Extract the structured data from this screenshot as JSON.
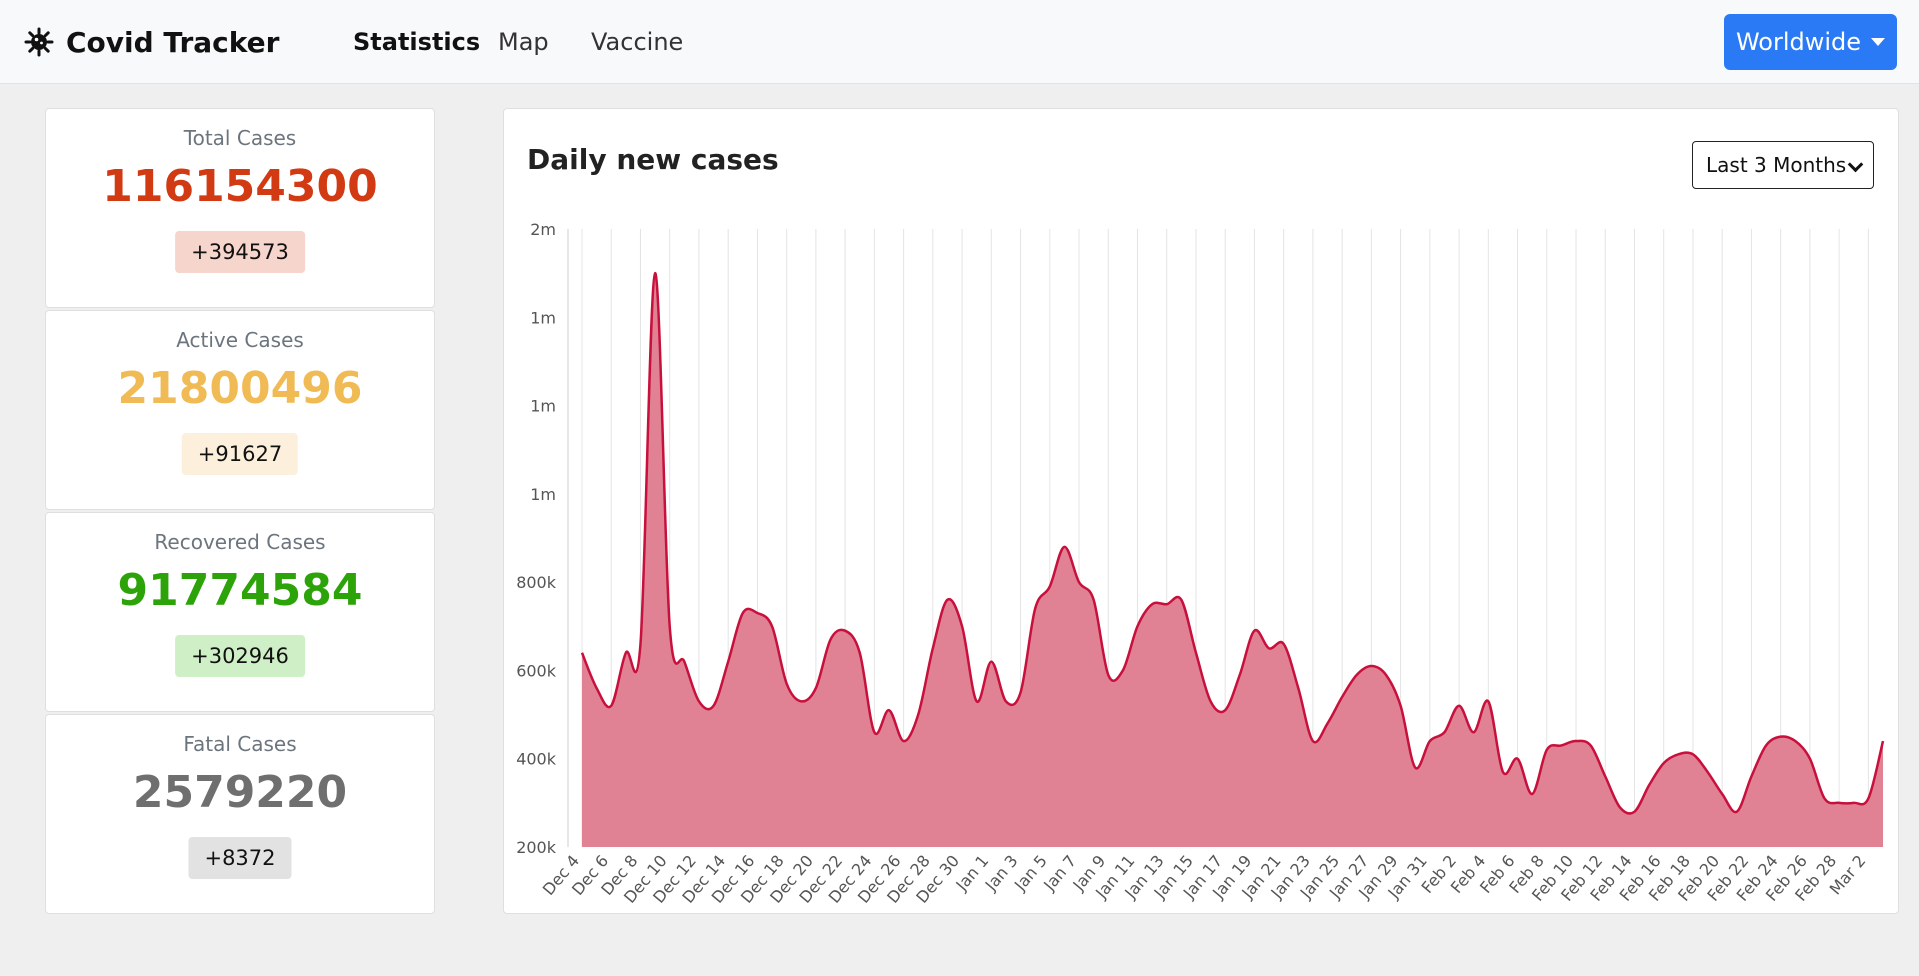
{
  "nav": {
    "brand": "Covid Tracker",
    "links": [
      "Statistics",
      "Map",
      "Vaccine"
    ],
    "region": "Worldwide"
  },
  "stats": [
    {
      "title": "Total Cases",
      "value": "116154300",
      "delta": "+394573",
      "color": "#d13a12",
      "bg": "#f5d5cc"
    },
    {
      "title": "Active Cases",
      "value": "21800496",
      "delta": "+91627",
      "color": "#f0bb55",
      "bg": "#fcf0dc"
    },
    {
      "title": "Recovered Cases",
      "value": "91774584",
      "delta": "+302946",
      "color": "#2da30a",
      "bg": "#cfefc6"
    },
    {
      "title": "Fatal Cases",
      "value": "2579220",
      "delta": "+8372",
      "color": "#6f6f6f",
      "bg": "#e2e2e2"
    }
  ],
  "chart": {
    "title": "Daily new cases",
    "range": "Last 3 Months"
  },
  "chart_data": {
    "type": "area",
    "line_color": "#c8103c",
    "fill_color": "#e08294",
    "grid": "vertical",
    "ylim": [
      200000,
      1600000
    ],
    "yticks": [
      200000,
      400000,
      600000,
      800000,
      1000000,
      1200000,
      1400000,
      1600000
    ],
    "ytick_labels": [
      "200k",
      "400k",
      "600k",
      "800k",
      "1m",
      "1m",
      "1m",
      "2m"
    ],
    "x": [
      "Dec 4",
      "Dec 5",
      "Dec 6",
      "Dec 7",
      "Dec 8",
      "Dec 9",
      "Dec 10",
      "Dec 11",
      "Dec 12",
      "Dec 13",
      "Dec 14",
      "Dec 15",
      "Dec 16",
      "Dec 17",
      "Dec 18",
      "Dec 19",
      "Dec 20",
      "Dec 21",
      "Dec 22",
      "Dec 23",
      "Dec 24",
      "Dec 25",
      "Dec 26",
      "Dec 27",
      "Dec 28",
      "Dec 29",
      "Dec 30",
      "Dec 31",
      "Jan 1",
      "Jan 2",
      "Jan 3",
      "Jan 4",
      "Jan 5",
      "Jan 6",
      "Jan 7",
      "Jan 8",
      "Jan 9",
      "Jan 10",
      "Jan 11",
      "Jan 12",
      "Jan 13",
      "Jan 14",
      "Jan 15",
      "Jan 16",
      "Jan 17",
      "Jan 18",
      "Jan 19",
      "Jan 20",
      "Jan 21",
      "Jan 22",
      "Jan 23",
      "Jan 24",
      "Jan 25",
      "Jan 26",
      "Jan 27",
      "Jan 28",
      "Jan 29",
      "Jan 30",
      "Jan 31",
      "Feb 1",
      "Feb 2",
      "Feb 3",
      "Feb 4",
      "Feb 5",
      "Feb 6",
      "Feb 7",
      "Feb 8",
      "Feb 9",
      "Feb 10",
      "Feb 11",
      "Feb 12",
      "Feb 13",
      "Feb 14",
      "Feb 15",
      "Feb 16",
      "Feb 17",
      "Feb 18",
      "Feb 19",
      "Feb 20",
      "Feb 21",
      "Feb 22",
      "Feb 23",
      "Feb 24",
      "Feb 25",
      "Feb 26",
      "Feb 27",
      "Feb 28",
      "Mar 1",
      "Mar 2",
      "Mar 3"
    ],
    "xtick_labels": [
      "Dec 4",
      "Dec 6",
      "Dec 8",
      "Dec 10",
      "Dec 12",
      "Dec 14",
      "Dec 16",
      "Dec 18",
      "Dec 20",
      "Dec 22",
      "Dec 24",
      "Dec 26",
      "Dec 28",
      "Dec 30",
      "Jan 1",
      "Jan 3",
      "Jan 5",
      "Jan 7",
      "Jan 9",
      "Jan 11",
      "Jan 13",
      "Jan 15",
      "Jan 17",
      "Jan 19",
      "Jan 21",
      "Jan 23",
      "Jan 25",
      "Jan 27",
      "Jan 29",
      "Jan 31",
      "Feb 2",
      "Feb 4",
      "Feb 6",
      "Feb 8",
      "Feb 10",
      "Feb 12",
      "Feb 14",
      "Feb 16",
      "Feb 18",
      "Feb 20",
      "Feb 22",
      "Feb 24",
      "Feb 26",
      "Feb 28",
      "Mar 2"
    ],
    "values": [
      640000,
      560000,
      520000,
      640000,
      660000,
      1500000,
      700000,
      620000,
      530000,
      520000,
      620000,
      730000,
      730000,
      700000,
      570000,
      530000,
      560000,
      670000,
      690000,
      640000,
      460000,
      510000,
      440000,
      500000,
      650000,
      760000,
      700000,
      530000,
      620000,
      530000,
      550000,
      740000,
      790000,
      880000,
      800000,
      760000,
      590000,
      600000,
      700000,
      750000,
      750000,
      760000,
      640000,
      530000,
      510000,
      590000,
      690000,
      650000,
      660000,
      560000,
      440000,
      480000,
      540000,
      590000,
      610000,
      590000,
      520000,
      380000,
      440000,
      460000,
      520000,
      460000,
      530000,
      370000,
      400000,
      320000,
      420000,
      430000,
      440000,
      430000,
      360000,
      290000,
      280000,
      340000,
      390000,
      410000,
      410000,
      370000,
      320000,
      280000,
      360000,
      430000,
      450000,
      440000,
      400000,
      310000,
      300000,
      300000,
      310000,
      440000
    ]
  }
}
